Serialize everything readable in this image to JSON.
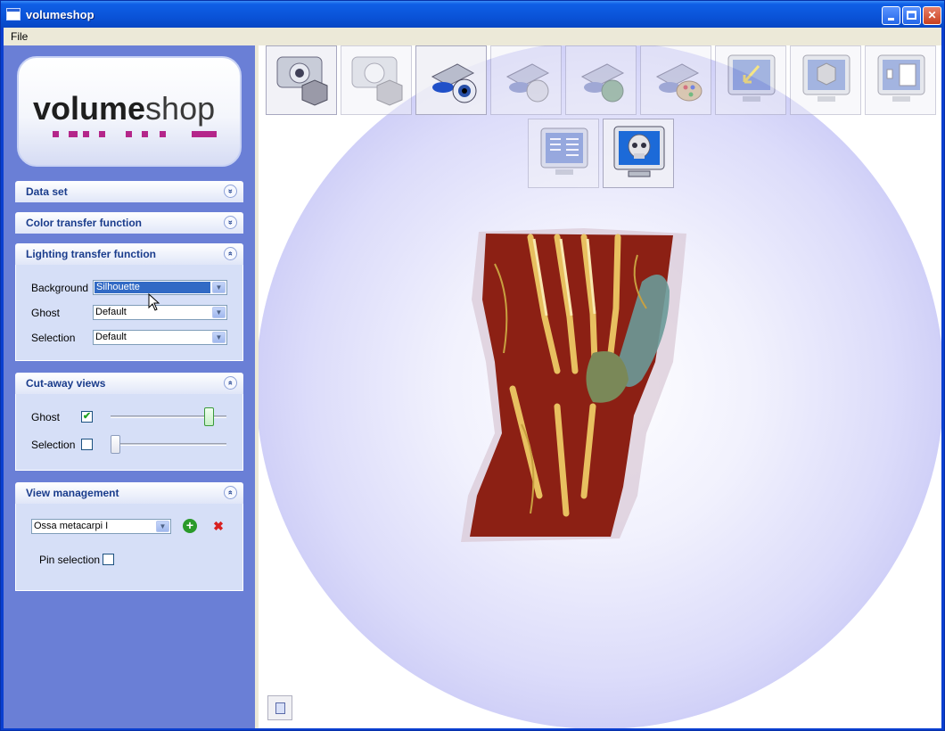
{
  "window": {
    "title": "volumeshop"
  },
  "menu": {
    "file": "File"
  },
  "logo": {
    "word1": "volume",
    "word2": "shop"
  },
  "panels": {
    "dataset": {
      "title": "Data set"
    },
    "color_tf": {
      "title": "Color transfer function"
    },
    "lighting_tf": {
      "title": "Lighting transfer function",
      "background_label": "Background",
      "background_value": "Silhouette",
      "ghost_label": "Ghost",
      "ghost_value": "Default",
      "selection_label": "Selection",
      "selection_value": "Default"
    },
    "cutaway": {
      "title": "Cut-away views",
      "ghost_label": "Ghost",
      "ghost_checked": "✔",
      "ghost_level": 0.88,
      "selection_label": "Selection",
      "selection_level": 0.0
    },
    "view_mgmt": {
      "title": "View management",
      "view_value": "Ossa metacarpi I",
      "pin_label": "Pin selection"
    }
  },
  "chevrons": {
    "collapsed": "»",
    "expanded": "«"
  },
  "icons": {
    "add": "+",
    "delete": "✖",
    "arrow": "▼"
  },
  "toolbar": [
    "camera-cube-icon",
    "camera-cube-grey-icon",
    "projector-eye-icon",
    "projector-skull-icon",
    "projector-green-skull-icon",
    "projector-palette-icon",
    "monitor-arrow-icon",
    "monitor-cube-icon",
    "monitor-layout-icon",
    "monitor-grid-icon",
    "monitor-skull-icon"
  ],
  "colors": {
    "sidebar": "#6a7fd6",
    "titlebar": "#0a53d8",
    "panel_title": "#1a3c8c",
    "sphere_edge": "#b8b8f2"
  }
}
